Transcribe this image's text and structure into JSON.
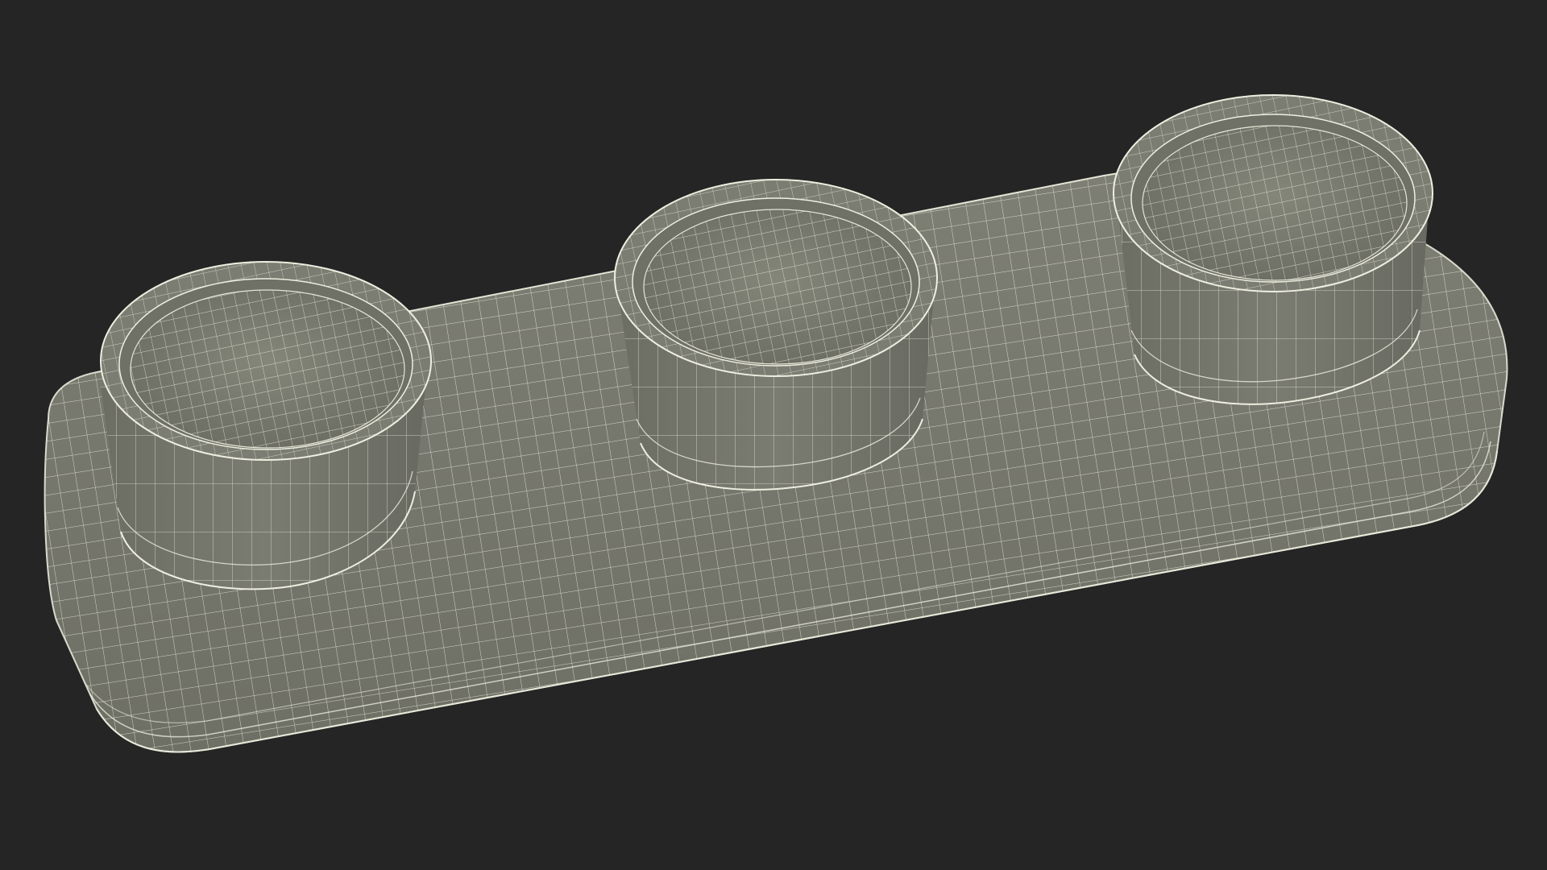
{
  "scene": {
    "background_color": "#252525",
    "mesh_fill_color": "#75766b",
    "mesh_shade_color": "#5e5f56",
    "wire_color": "#f2f2e6",
    "object": "wireframe-tray-with-three-round-cups"
  }
}
